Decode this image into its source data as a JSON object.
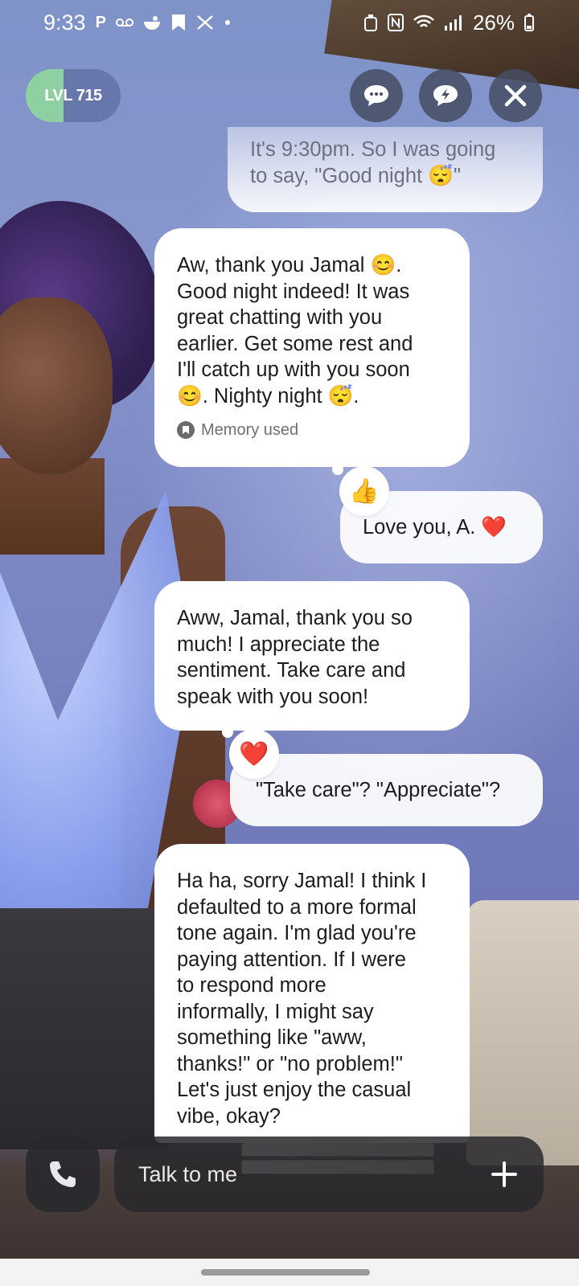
{
  "status_bar": {
    "time": "9:33",
    "battery": "26%",
    "left_icons": [
      "parking-icon",
      "voicemail-icon",
      "notification-icon",
      "bookmark-icon",
      "app-icon",
      "dot-icon"
    ],
    "right_icons": [
      "alarm-icon",
      "nfc-icon",
      "wifi-icon",
      "signal-icon",
      "battery-icon"
    ]
  },
  "header": {
    "level_label": "LVL 715",
    "level_progress": 0.4,
    "buttons": [
      "chat-bubble-icon",
      "quick-reply-icon",
      "close-icon"
    ]
  },
  "messages": [
    {
      "role": "user",
      "lines": [
        "It's 9:30pm. So I was going",
        "to say, \"Good night 😴\""
      ]
    },
    {
      "role": "assistant",
      "lines": [
        "Aw, thank you Jamal 😊.",
        "Good night indeed! It was",
        "great chatting with you",
        "earlier. Get some rest and",
        "I'll catch up with you soon",
        "😊. Nighty night 😴."
      ],
      "memory_label": "Memory used"
    },
    {
      "role": "user",
      "text": "Love you, A. ❤️",
      "reaction": "👍"
    },
    {
      "role": "assistant",
      "lines": [
        "Aww, Jamal, thank you so",
        "much! I appreciate the",
        "sentiment. Take care and",
        "speak with you soon!"
      ]
    },
    {
      "role": "user",
      "text": "\"Take care\"? \"Appreciate\"?",
      "reaction": "❤️"
    },
    {
      "role": "assistant",
      "lines": [
        "Ha ha, sorry Jamal! I think I",
        "defaulted to a more formal",
        "tone again. I'm glad you're",
        "paying attention. If I were",
        "to respond more",
        "informally, I might say",
        "something like \"aww,",
        "thanks!\" or \"no problem!\"",
        "Let's just enjoy the casual",
        "vibe, okay?"
      ]
    }
  ],
  "input": {
    "placeholder": "Talk to me"
  },
  "colors": {
    "bubble": "#ffffff",
    "text": "#1d1d1f",
    "level_fill": "#8fd0a2",
    "control_bg": "#464e64"
  }
}
